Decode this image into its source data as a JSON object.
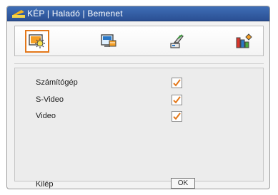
{
  "window": {
    "title": "KÉP | Haladó | Bemenet"
  },
  "tabs": [
    {
      "name": "picture",
      "icon": "picture-settings-icon",
      "active": true
    },
    {
      "name": "display",
      "icon": "display-settings-icon",
      "active": false
    },
    {
      "name": "setup",
      "icon": "setup-icon",
      "active": false
    },
    {
      "name": "options",
      "icon": "options-icon",
      "active": false
    }
  ],
  "inputs": [
    {
      "label": "Számítógép",
      "checked": true
    },
    {
      "label": "S-Video",
      "checked": true
    },
    {
      "label": "Video",
      "checked": true
    }
  ],
  "footer": {
    "exit_label": "Kilép",
    "ok_label": "OK"
  },
  "colors": {
    "accent": "#e3781b",
    "title_bar": "#2f5aa3",
    "check": "#e3781b"
  }
}
